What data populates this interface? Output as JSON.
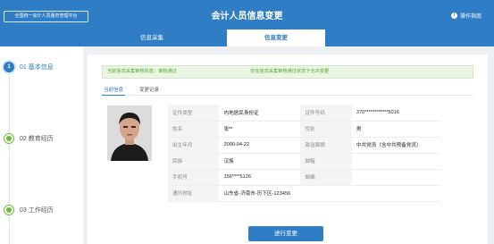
{
  "header": {
    "platform_link": "全国统一会计人员服务管理平台",
    "title": "会计人员信息变更",
    "guide_label": "操作指南"
  },
  "tabs": [
    {
      "label": "信息采集"
    },
    {
      "label": "信息变更"
    }
  ],
  "steps": [
    {
      "num": "1",
      "label": "01 基本信息"
    },
    {
      "num": "",
      "label": "02 教育经历"
    },
    {
      "num": "",
      "label": "03 工作经历"
    }
  ],
  "notice": {
    "status_text": "当前信息采集审核状态：审核通过",
    "tip_text": "仅在信息采集审核通过状态下允许变更"
  },
  "subtabs": [
    {
      "label": "当前信息"
    },
    {
      "label": "变更记录"
    }
  ],
  "info": {
    "id_type_label": "证件类型",
    "id_type": "内地居民身份证",
    "id_no_label": "证件号码",
    "id_no": "370************5016",
    "name_label": "姓名",
    "name": "张**",
    "gender_label": "性别",
    "gender": "男",
    "birth_label": "出生年月",
    "birth": "2000-04-22",
    "political_label": "政治面貌",
    "political": "中共党员（含中共预备党员）",
    "ethnic_label": "民族",
    "ethnic": "汉族",
    "email_label": "邮箱",
    "email": "",
    "phone_label": "手机号",
    "phone": "156****5126",
    "postcode_label": "邮编",
    "postcode": "",
    "address_label": "通讯地址",
    "address": "山东省-济南市-历下区-123456"
  },
  "actions": {
    "submit_label": "进行变更"
  },
  "colors": {
    "primary": "#2f7dc4",
    "success": "#55a532"
  }
}
